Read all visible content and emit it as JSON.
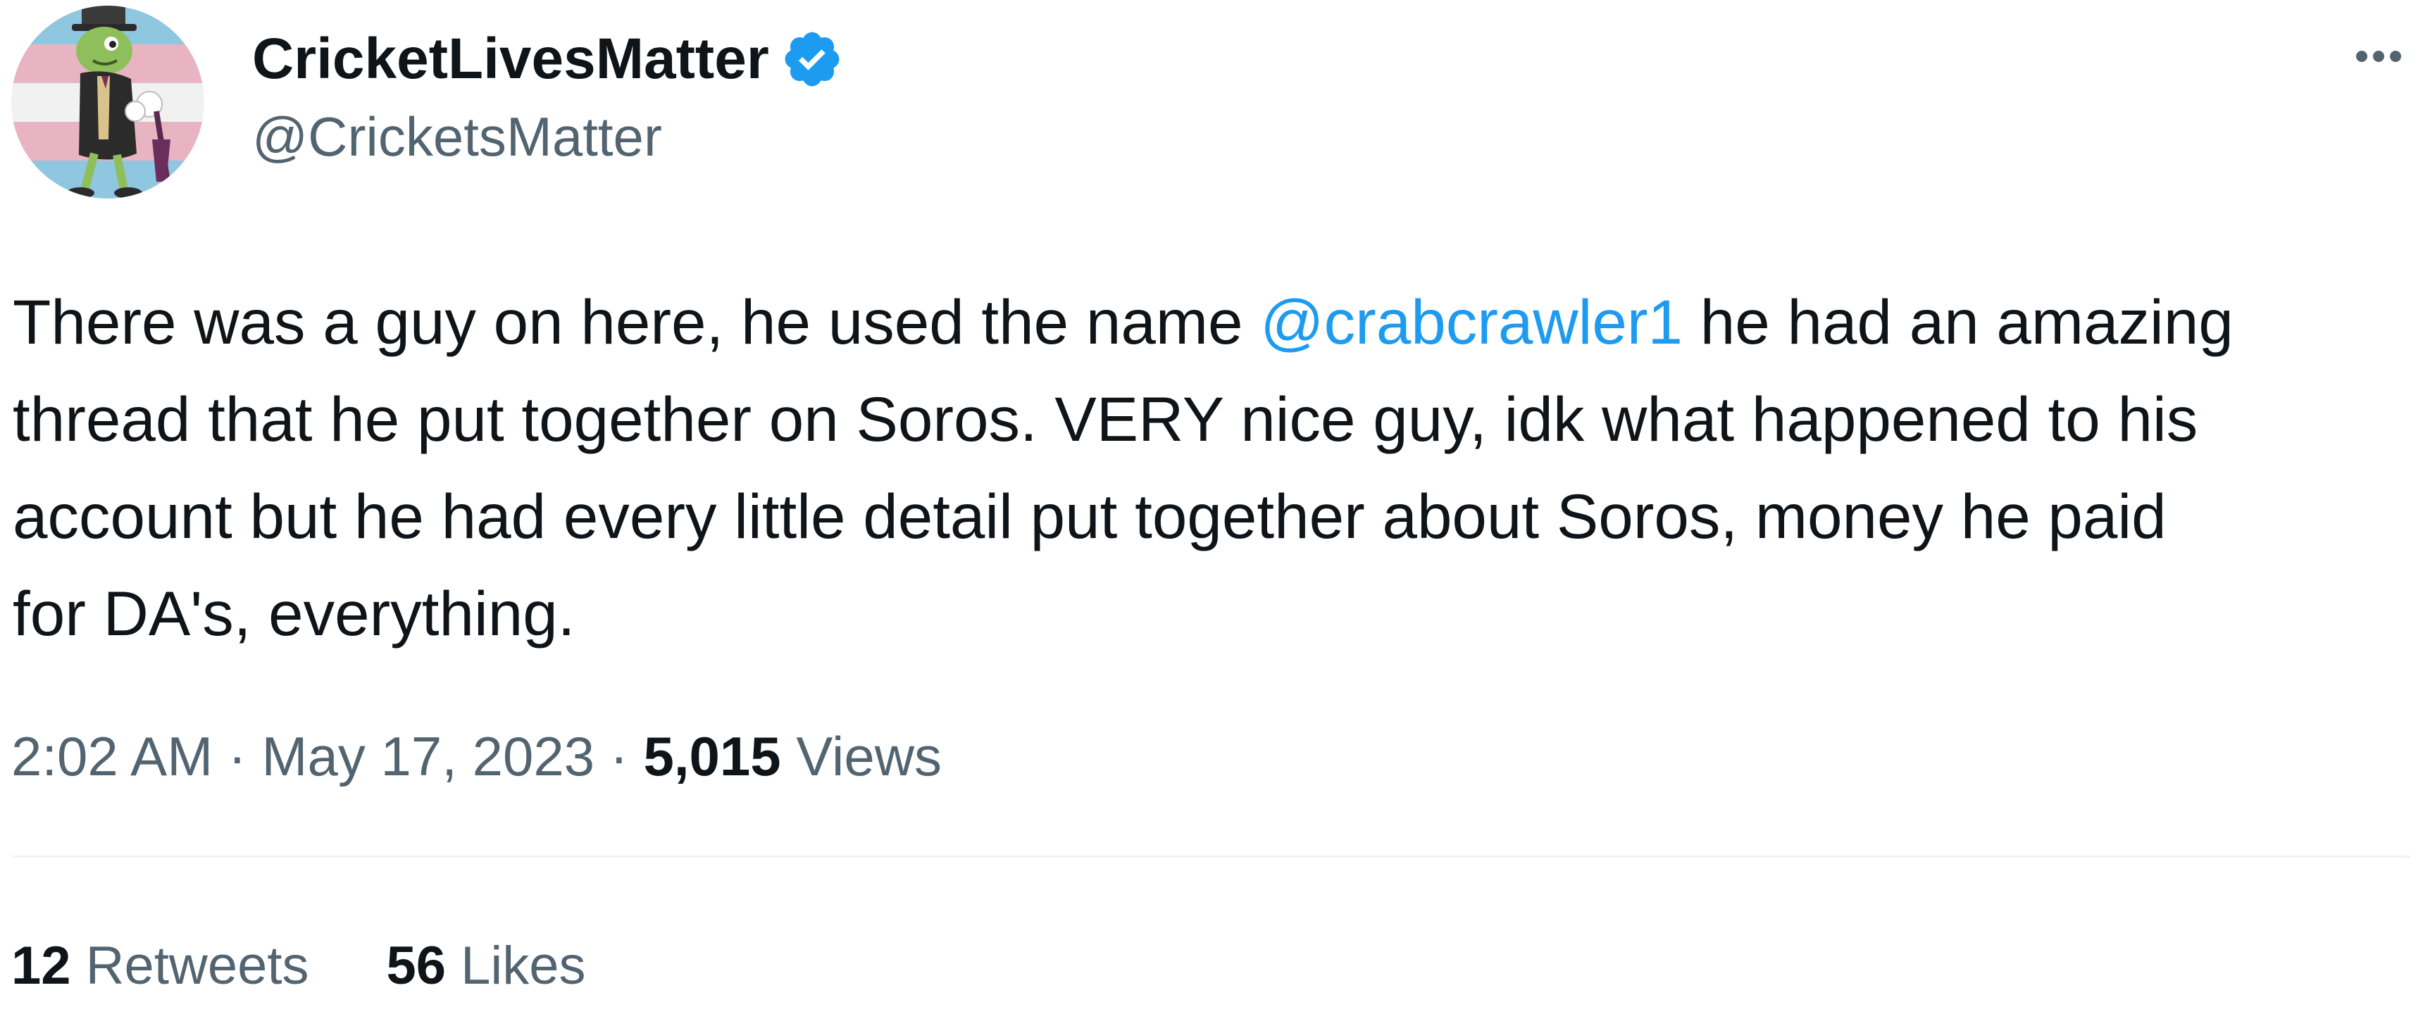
{
  "tweet": {
    "author": {
      "display_name": "CricketLivesMatter",
      "handle": "@CricketsMatter",
      "verified": true,
      "verified_color": "#1d9bf0"
    },
    "text": {
      "line1_before": "There was a guy on here, he used the name ",
      "mention": "@crabcrawler1",
      "line1_after": " he had an amazing",
      "line2": "thread that he put together on Soros. VERY nice guy, idk what happened to his",
      "line3": "account but he had every little detail put together about Soros, money he paid",
      "line4": "for DA's, everything."
    },
    "meta": {
      "time": "2:02 AM",
      "separator": " · ",
      "date": "May 17, 2023",
      "views_count": "5,015",
      "views_label": " Views"
    },
    "stats": {
      "retweets_count": "12",
      "retweets_label": " Retweets",
      "likes_count": "56",
      "likes_label": " Likes"
    }
  },
  "icons": {
    "verified": "verified-badge-icon",
    "more": "more-options-icon"
  },
  "colors": {
    "text_primary": "#0f1419",
    "text_secondary": "#536471",
    "link": "#1d9bf0",
    "divider": "#eff3f4"
  }
}
